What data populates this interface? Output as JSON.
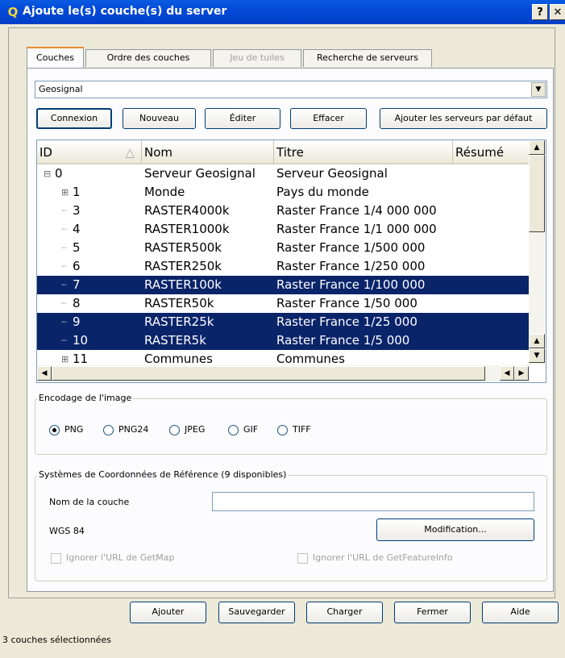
{
  "window": {
    "title": "Ajoute le(s) couche(s) du server",
    "help_btn": "?",
    "close_btn": "✕"
  },
  "tabs": [
    {
      "label": "Couches",
      "state": "active"
    },
    {
      "label": "Ordre des couches",
      "state": "normal"
    },
    {
      "label": "Jeu de tuiles",
      "state": "disabled"
    },
    {
      "label": "Recherche de serveurs",
      "state": "normal"
    }
  ],
  "server_combo": {
    "value": "Geosignal"
  },
  "server_buttons": {
    "connect": "Connexion",
    "new": "Nouveau",
    "edit": "Éditer",
    "delete": "Effacer",
    "add_default": "Ajouter les serveurs par défaut"
  },
  "table": {
    "headers": [
      "ID",
      "Nom",
      "Titre",
      "Résumé"
    ],
    "rows": [
      {
        "id": "0",
        "name": "Serveur Geosignal",
        "title": "Serveur Geosignal",
        "expander": "⊟",
        "selected": false
      },
      {
        "id": "1",
        "name": "Monde",
        "title": "Pays du monde",
        "expander": "⊞",
        "selected": false
      },
      {
        "id": "3",
        "name": "RASTER4000k",
        "title": "Raster France 1/4 000 000",
        "selected": false
      },
      {
        "id": "4",
        "name": "RASTER1000k",
        "title": "Raster France 1/1 000 000",
        "selected": false
      },
      {
        "id": "5",
        "name": "RASTER500k",
        "title": "Raster France 1/500 000",
        "selected": false
      },
      {
        "id": "6",
        "name": "RASTER250k",
        "title": "Raster France 1/250 000",
        "selected": false
      },
      {
        "id": "7",
        "name": "RASTER100k",
        "title": "Raster France 1/100 000",
        "selected": true
      },
      {
        "id": "8",
        "name": "RASTER50k",
        "title": "Raster France 1/50 000",
        "selected": false
      },
      {
        "id": "9",
        "name": "RASTER25k",
        "title": "Raster France 1/25 000",
        "selected": true
      },
      {
        "id": "10",
        "name": "RASTER5k",
        "title": "Raster France 1/5 000",
        "selected": true
      },
      {
        "id": "11",
        "name": "Communes",
        "title": "Communes",
        "expander": "⊞",
        "selected": false
      }
    ]
  },
  "image_encoding": {
    "label": "Encodage de l'image",
    "options": [
      "PNG",
      "PNG24",
      "JPEG",
      "GIF",
      "TIFF"
    ],
    "selected": "PNG"
  },
  "crs": {
    "label": "Systèmes de Coordonnées de Référence (9 disponibles)",
    "layer_name_label": "Nom de la couche",
    "layer_name_value": "",
    "crs_name": "WGS 84",
    "modify_btn": "Modification...",
    "ignore_getmap": "Ignorer l'URL de GetMap",
    "ignore_getfeatureinfo": "Ignorer l'URL de GetFeatureInfo"
  },
  "bottom_buttons": {
    "add": "Ajouter",
    "save": "Sauvegarder",
    "load": "Charger",
    "close": "Fermer",
    "help": "Aide"
  },
  "status": "3 couches sélectionnées"
}
